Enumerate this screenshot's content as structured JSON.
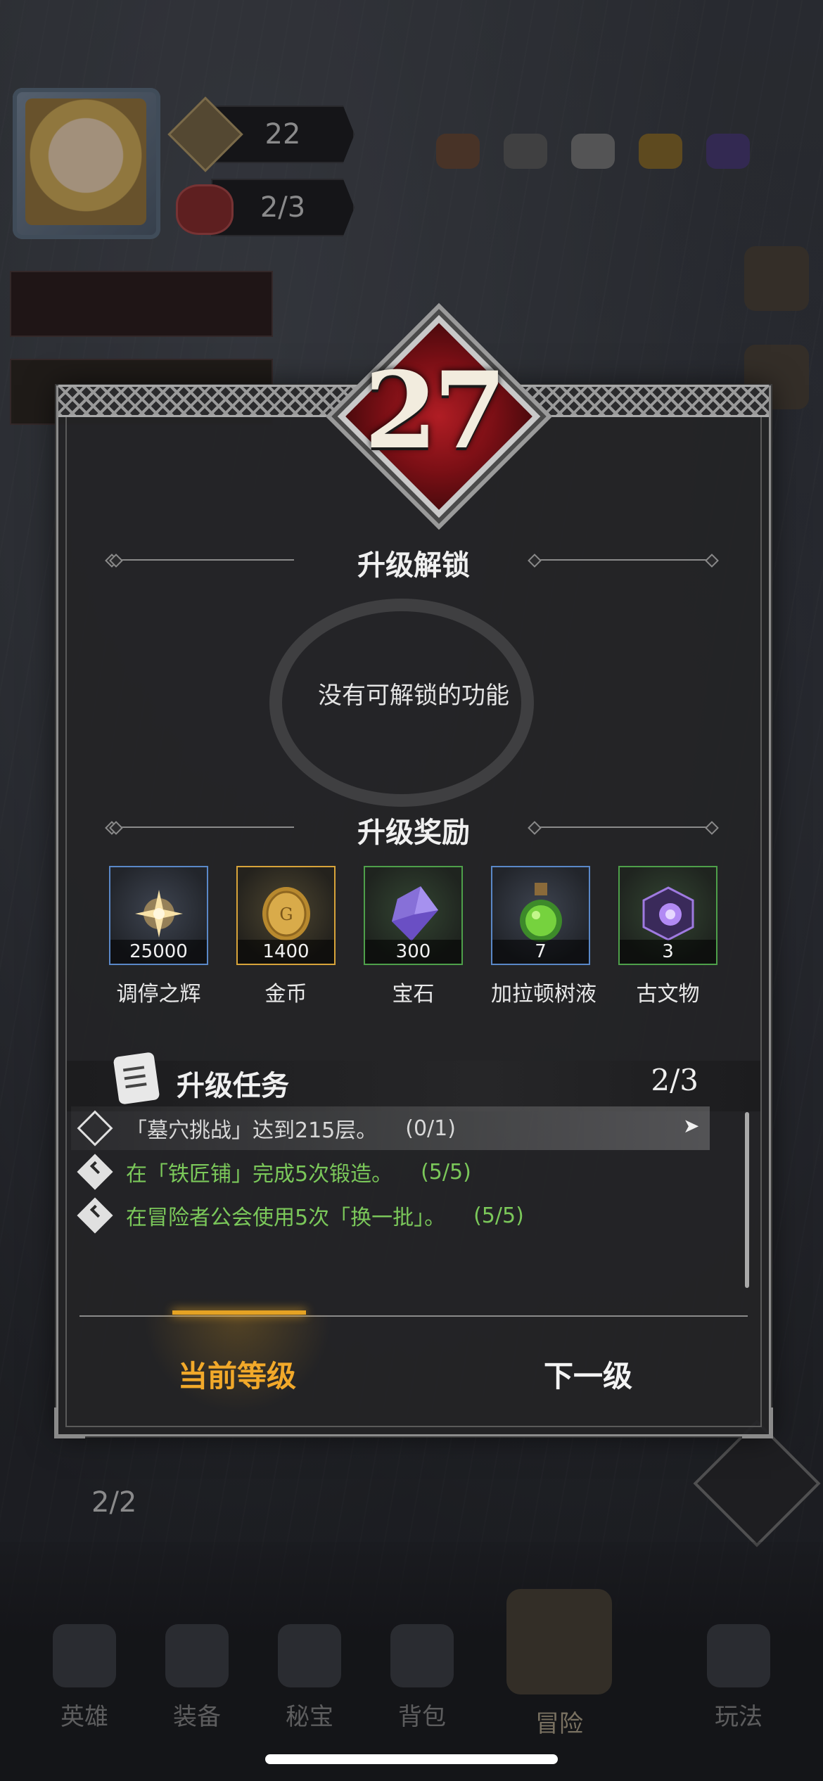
{
  "player": {
    "power_value": "22",
    "hp_value": "2/3"
  },
  "bottom_nav": {
    "items": [
      "英雄",
      "装备",
      "秘宝",
      "背包",
      "冒险",
      "玩法"
    ],
    "left_counter": "2/2"
  },
  "modal": {
    "level": "27",
    "unlock_title": "升级解锁",
    "no_unlock_text": "没有可解锁的功能",
    "reward_title": "升级奖励",
    "rewards": [
      {
        "qty": "25000",
        "name": "调停之辉",
        "rarity": "blue",
        "icon": "radiant-star-icon"
      },
      {
        "qty": "1400",
        "name": "金币",
        "rarity": "gold",
        "icon": "gold-coin-icon"
      },
      {
        "qty": "300",
        "name": "宝石",
        "rarity": "green",
        "icon": "purple-gem-icon"
      },
      {
        "qty": "7",
        "name": "加拉顿树液",
        "rarity": "blue",
        "icon": "green-potion-icon"
      },
      {
        "qty": "3",
        "name": "古文物",
        "rarity": "green",
        "icon": "relic-cube-icon"
      }
    ],
    "task_title": "升级任务",
    "task_progress": "2/3",
    "tasks": [
      {
        "text": "「墓穴挑战」达到215层。",
        "progress": "(0/1)",
        "done": false
      },
      {
        "text": "在「铁匠铺」完成5次锻造。",
        "progress": "(5/5)",
        "done": true
      },
      {
        "text": "在冒险者公会使用5次「换一批」。",
        "progress": "(5/5)",
        "done": true
      }
    ],
    "tabs": {
      "current": "当前等级",
      "next": "下一级"
    }
  },
  "colors": {
    "accent_gold": "#f2a92a",
    "done_green": "#7bc85a",
    "level_red": "#b01d24"
  }
}
